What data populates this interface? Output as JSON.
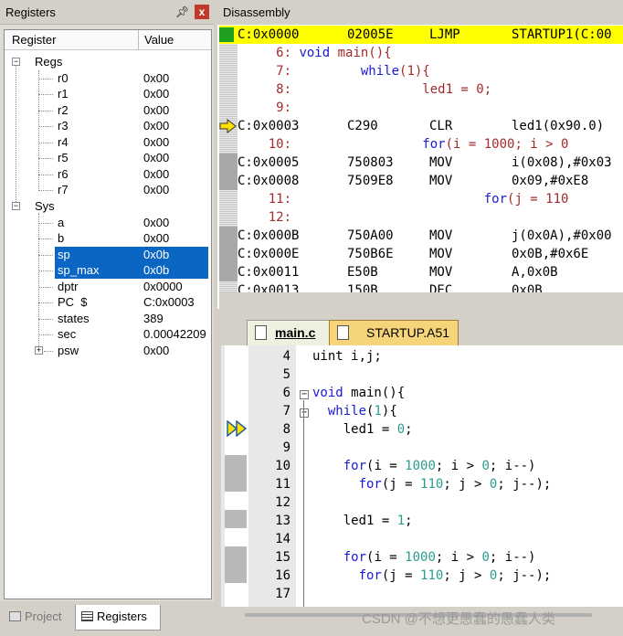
{
  "registers_panel": {
    "title": "Registers",
    "pin_icon": "pin-icon",
    "close_label": "x",
    "col_register": "Register",
    "col_value": "Value",
    "regs_group": "Regs",
    "regs": [
      {
        "name": "r0",
        "value": "0x00"
      },
      {
        "name": "r1",
        "value": "0x00"
      },
      {
        "name": "r2",
        "value": "0x00"
      },
      {
        "name": "r3",
        "value": "0x00"
      },
      {
        "name": "r4",
        "value": "0x00"
      },
      {
        "name": "r5",
        "value": "0x00"
      },
      {
        "name": "r6",
        "value": "0x00"
      },
      {
        "name": "r7",
        "value": "0x00"
      }
    ],
    "sys_group": "Sys",
    "sys": [
      {
        "name": "a",
        "value": "0x00"
      },
      {
        "name": "b",
        "value": "0x00"
      },
      {
        "name": "sp",
        "value": "0x0b"
      },
      {
        "name": "sp_max",
        "value": "0x0b"
      },
      {
        "name": "dptr",
        "value": "0x0000"
      },
      {
        "name": "PC  $",
        "value": "C:0x0003"
      },
      {
        "name": "states",
        "value": "389"
      },
      {
        "name": "sec",
        "value": "0.00042209"
      },
      {
        "name": "psw",
        "value": "0x00"
      }
    ],
    "tabs": [
      "Project",
      "Registers"
    ]
  },
  "disassembly": {
    "title": "Disassembly",
    "lines": [
      {
        "addr": "C:0x0000",
        "op": "02005E",
        "mn": "LJMP",
        "arg": "STARTUP1(C:00",
        "type": "asm"
      },
      {
        "text": "     6: void main(){",
        "type": "src"
      },
      {
        "text": "     7:         while(1){",
        "type": "src"
      },
      {
        "text": "     8:                 led1 = 0;",
        "type": "src"
      },
      {
        "text": "     9:",
        "type": "src"
      },
      {
        "addr": "C:0x0003",
        "op": "C290",
        "mn": "CLR",
        "arg": "led1(0x90.0)",
        "type": "asm"
      },
      {
        "text": "    10:                 for(i = 1000; i > 0",
        "type": "src"
      },
      {
        "addr": "C:0x0005",
        "op": "750803",
        "mn": "MOV",
        "arg": "i(0x08),#0x03",
        "type": "asm"
      },
      {
        "addr": "C:0x0008",
        "op": "7509E8",
        "mn": "MOV",
        "arg": "0x09,#0xE8",
        "type": "asm"
      },
      {
        "text": "    11:                         for(j = 110",
        "type": "src"
      },
      {
        "text": "    12:",
        "type": "src"
      },
      {
        "addr": "C:0x000B",
        "op": "750A00",
        "mn": "MOV",
        "arg": "j(0x0A),#0x00",
        "type": "asm"
      },
      {
        "addr": "C:0x000E",
        "op": "750B6E",
        "mn": "MOV",
        "arg": "0x0B,#0x6E",
        "type": "asm"
      },
      {
        "addr": "C:0x0011",
        "op": "E50B",
        "mn": "MOV",
        "arg": "A,0x0B",
        "type": "asm"
      },
      {
        "addr": "C:0x0013",
        "op": "150B",
        "mn": "DEC",
        "arg": "0x0B",
        "type": "asm"
      }
    ]
  },
  "editor": {
    "tabs": [
      "main.c",
      "STARTUP.A51"
    ],
    "lines": [
      {
        "n": "4",
        "code": "uint i,j;"
      },
      {
        "n": "5",
        "code": ""
      },
      {
        "n": "6",
        "code": "void main(){"
      },
      {
        "n": "7",
        "code": "  while(1){"
      },
      {
        "n": "8",
        "code": "    led1 = 0;"
      },
      {
        "n": "9",
        "code": ""
      },
      {
        "n": "10",
        "code": "    for(i = 1000; i > 0; i--)"
      },
      {
        "n": "11",
        "code": "      for(j = 110; j > 0; j--);"
      },
      {
        "n": "12",
        "code": ""
      },
      {
        "n": "13",
        "code": "    led1 = 1;"
      },
      {
        "n": "14",
        "code": ""
      },
      {
        "n": "15",
        "code": "    for(i = 1000; i > 0; i--)"
      },
      {
        "n": "16",
        "code": "      for(j = 110; j > 0; j--);"
      },
      {
        "n": "17",
        "code": ""
      }
    ]
  },
  "watermark": "CSDN @不想更愚蠢的愚蠢人类",
  "colors": {
    "selection": "#0b66c3",
    "pc_highlight": "#ffff00",
    "source_line": "#a52a2a",
    "keyword": "#1a1ad6",
    "number": "#2a9d8f"
  }
}
